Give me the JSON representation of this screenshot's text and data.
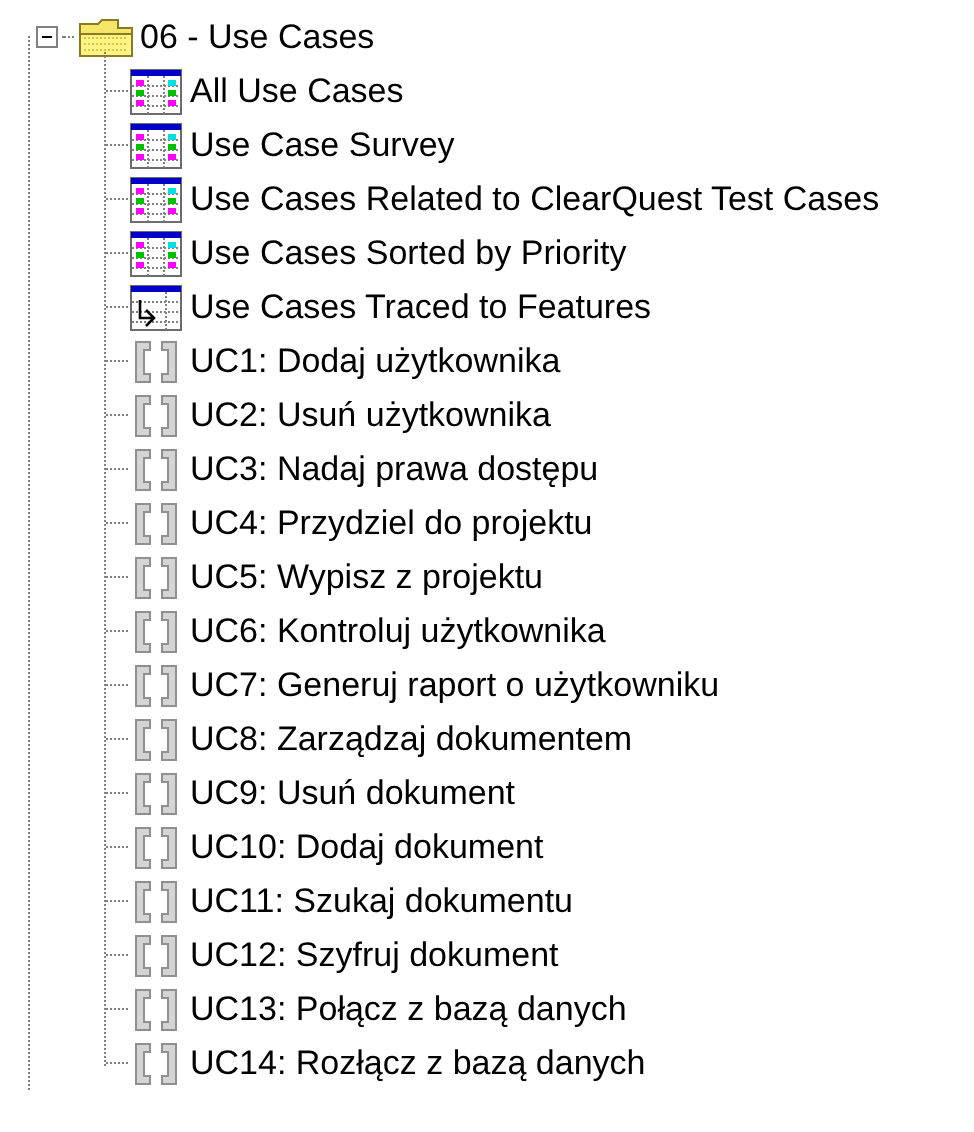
{
  "tree": {
    "label": "06 - Use Cases",
    "expanded": true,
    "children": [
      {
        "kind": "report",
        "label": "All Use Cases"
      },
      {
        "kind": "report",
        "label": "Use Case Survey"
      },
      {
        "kind": "report",
        "label": "Use Cases Related to ClearQuest Test Cases"
      },
      {
        "kind": "report",
        "label": "Use Cases Sorted by Priority"
      },
      {
        "kind": "trace",
        "label": "Use Cases Traced to Features"
      },
      {
        "kind": "usecase",
        "label": "UC1: Dodaj użytkownika"
      },
      {
        "kind": "usecase",
        "label": "UC2: Usuń użytkownika"
      },
      {
        "kind": "usecase",
        "label": "UC3: Nadaj prawa dostępu"
      },
      {
        "kind": "usecase",
        "label": "UC4: Przydziel do projektu"
      },
      {
        "kind": "usecase",
        "label": "UC5: Wypisz z projektu"
      },
      {
        "kind": "usecase",
        "label": "UC6: Kontroluj użytkownika"
      },
      {
        "kind": "usecase",
        "label": "UC7: Generuj raport o użytkowniku"
      },
      {
        "kind": "usecase",
        "label": "UC8: Zarządzaj dokumentem"
      },
      {
        "kind": "usecase",
        "label": "UC9: Usuń dokument"
      },
      {
        "kind": "usecase",
        "label": "UC10: Dodaj dokument"
      },
      {
        "kind": "usecase",
        "label": "UC11: Szukaj dokumentu"
      },
      {
        "kind": "usecase",
        "label": "UC12: Szyfruj dokument"
      },
      {
        "kind": "usecase",
        "label": "UC13: Połącz z bazą danych"
      },
      {
        "kind": "usecase",
        "label": "UC14: Rozłącz z bazą danych"
      }
    ]
  }
}
